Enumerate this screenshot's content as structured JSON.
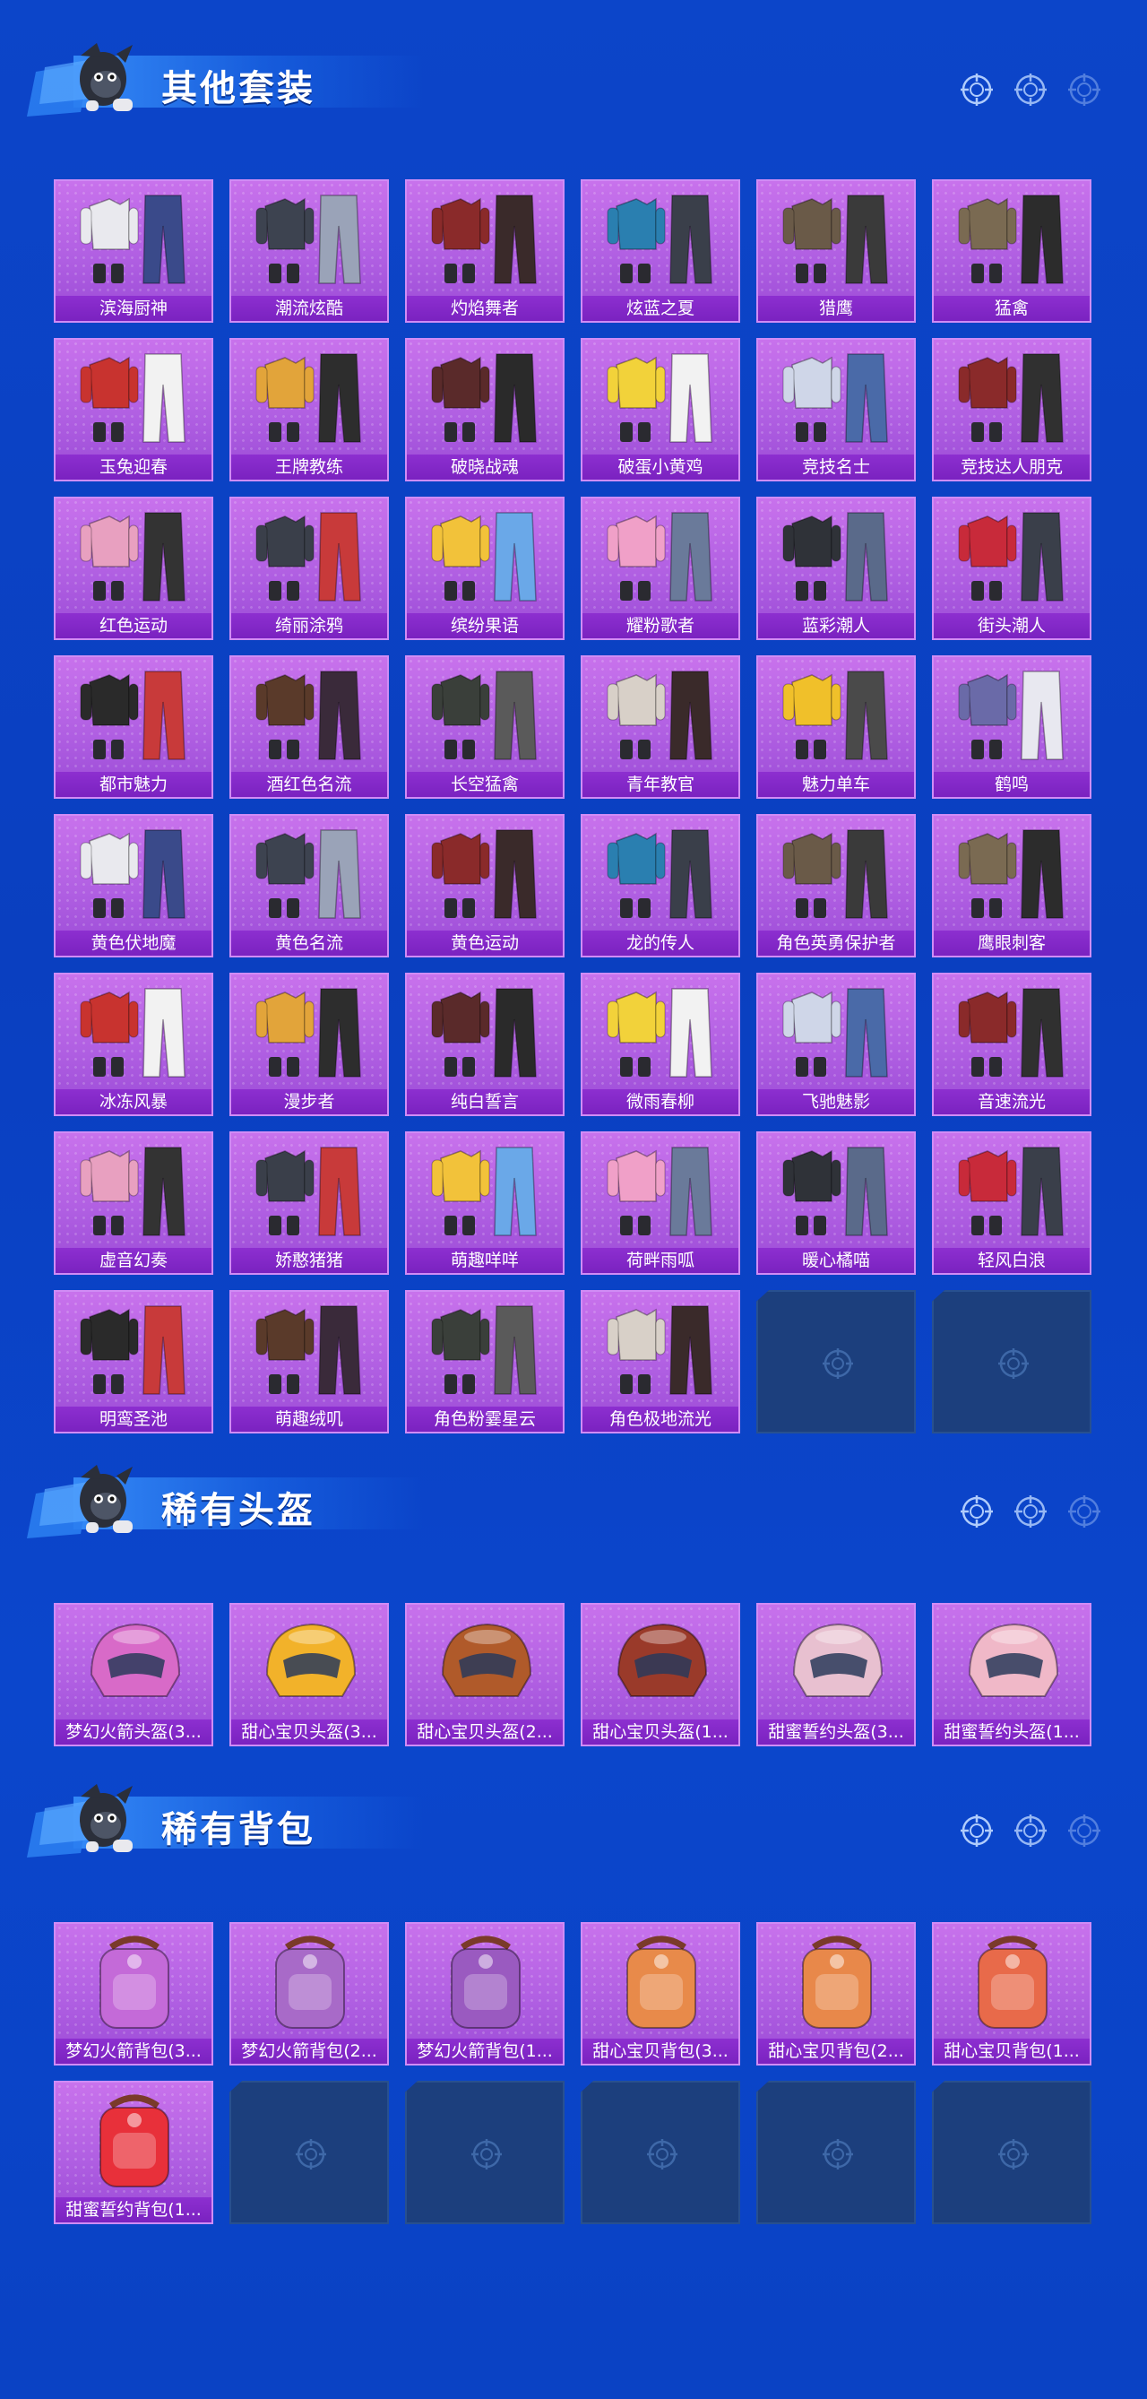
{
  "sections": [
    {
      "title": "其他套装",
      "items": [
        {
          "name": "滨海厨神",
          "icon": "outfit-icon"
        },
        {
          "name": "潮流炫酷",
          "icon": "outfit-icon"
        },
        {
          "name": "灼焰舞者",
          "icon": "outfit-icon"
        },
        {
          "name": "炫蓝之夏",
          "icon": "outfit-icon"
        },
        {
          "name": "猎鹰",
          "icon": "outfit-icon"
        },
        {
          "name": "猛禽",
          "icon": "outfit-icon"
        },
        {
          "name": "玉兔迎春",
          "icon": "outfit-icon"
        },
        {
          "name": "王牌教练",
          "icon": "outfit-icon"
        },
        {
          "name": "破晓战魂",
          "icon": "outfit-icon"
        },
        {
          "name": "破蛋小黄鸡",
          "icon": "outfit-icon"
        },
        {
          "name": "竞技名士",
          "icon": "outfit-icon"
        },
        {
          "name": "竞技达人朋克",
          "icon": "outfit-icon"
        },
        {
          "name": "红色运动",
          "icon": "outfit-icon"
        },
        {
          "name": "绮丽涂鸦",
          "icon": "outfit-icon"
        },
        {
          "name": "缤纷果语",
          "icon": "outfit-icon"
        },
        {
          "name": "耀粉歌者",
          "icon": "outfit-icon"
        },
        {
          "name": "蓝彩潮人",
          "icon": "outfit-icon"
        },
        {
          "name": "街头潮人",
          "icon": "outfit-icon"
        },
        {
          "name": "都市魅力",
          "icon": "outfit-icon"
        },
        {
          "name": "酒红色名流",
          "icon": "outfit-icon"
        },
        {
          "name": "长空猛禽",
          "icon": "outfit-icon"
        },
        {
          "name": "青年教官",
          "icon": "outfit-icon"
        },
        {
          "name": "魅力单车",
          "icon": "outfit-icon"
        },
        {
          "name": "鹤鸣",
          "icon": "outfit-icon"
        },
        {
          "name": "黄色伏地魔",
          "icon": "outfit-icon"
        },
        {
          "name": "黄色名流",
          "icon": "outfit-icon"
        },
        {
          "name": "黄色运动",
          "icon": "outfit-icon"
        },
        {
          "name": "龙的传人",
          "icon": "outfit-icon"
        },
        {
          "name": "角色英勇保护者",
          "icon": "outfit-icon"
        },
        {
          "name": "鹰眼刺客",
          "icon": "outfit-icon"
        },
        {
          "name": "冰冻风暴",
          "icon": "outfit-icon"
        },
        {
          "name": "漫步者",
          "icon": "outfit-icon"
        },
        {
          "name": "纯白誓言",
          "icon": "outfit-icon"
        },
        {
          "name": "微雨春柳",
          "icon": "outfit-icon"
        },
        {
          "name": "飞驰魅影",
          "icon": "outfit-icon"
        },
        {
          "name": "音速流光",
          "icon": "outfit-icon"
        },
        {
          "name": "虚音幻奏",
          "icon": "outfit-icon"
        },
        {
          "name": "娇憨猪猪",
          "icon": "outfit-icon"
        },
        {
          "name": "萌趣咩咩",
          "icon": "outfit-icon"
        },
        {
          "name": "荷畔雨呱",
          "icon": "outfit-icon"
        },
        {
          "name": "暖心橘喵",
          "icon": "outfit-icon"
        },
        {
          "name": "轻风白浪",
          "icon": "outfit-icon"
        },
        {
          "name": "明鸾圣池",
          "icon": "outfit-icon"
        },
        {
          "name": "萌趣绒叽",
          "icon": "outfit-icon"
        },
        {
          "name": "角色粉霎星云",
          "icon": "outfit-icon"
        },
        {
          "name": "角色极地流光",
          "icon": "outfit-icon"
        }
      ],
      "empty_slots": 2
    },
    {
      "title": "稀有头盔",
      "items": [
        {
          "name": "梦幻火箭头盔(3...",
          "icon": "helmet-icon"
        },
        {
          "name": "甜心宝贝头盔(3...",
          "icon": "helmet-icon"
        },
        {
          "name": "甜心宝贝头盔(2...",
          "icon": "helmet-icon"
        },
        {
          "name": "甜心宝贝头盔(1...",
          "icon": "helmet-icon"
        },
        {
          "name": "甜蜜誓约头盔(3...",
          "icon": "helmet-icon"
        },
        {
          "name": "甜蜜誓约头盔(1...",
          "icon": "helmet-icon"
        }
      ],
      "empty_slots": 0
    },
    {
      "title": "稀有背包",
      "items": [
        {
          "name": "梦幻火箭背包(3...",
          "icon": "backpack-icon"
        },
        {
          "name": "梦幻火箭背包(2...",
          "icon": "backpack-icon"
        },
        {
          "name": "梦幻火箭背包(1...",
          "icon": "backpack-icon"
        },
        {
          "name": "甜心宝贝背包(3...",
          "icon": "backpack-icon"
        },
        {
          "name": "甜心宝贝背包(2...",
          "icon": "backpack-icon"
        },
        {
          "name": "甜心宝贝背包(1...",
          "icon": "backpack-icon"
        },
        {
          "name": "甜蜜誓约背包(1...",
          "icon": "backpack-icon"
        }
      ],
      "empty_slots": 5
    }
  ],
  "colors": {
    "background": "#0b43c6",
    "tile": "#b05fe2",
    "label_bar": "#8d2fd0",
    "empty_slot": "#1c3f7d"
  }
}
